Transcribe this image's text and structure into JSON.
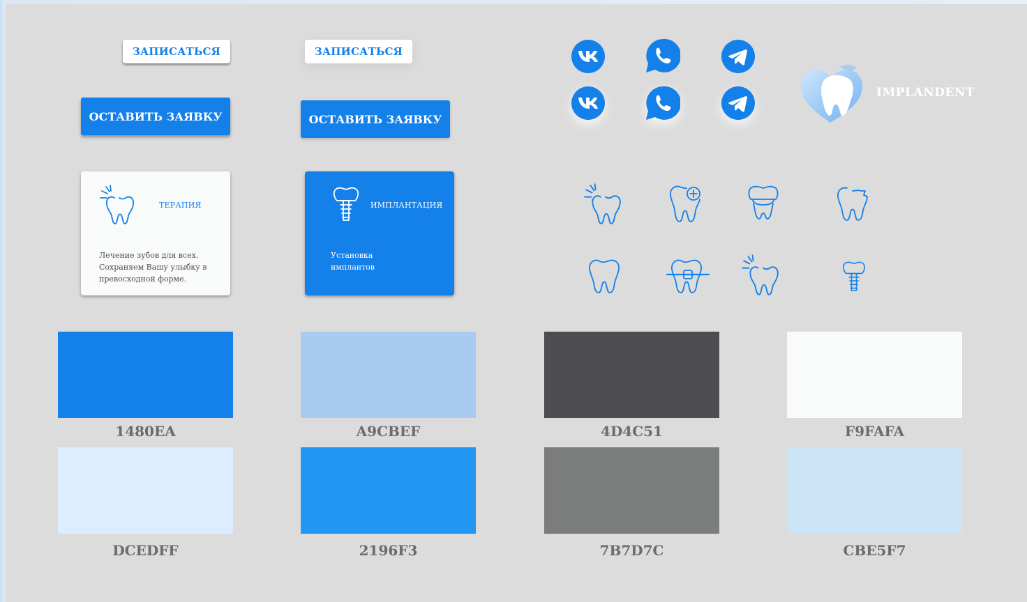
{
  "buttons": {
    "signup_label": "ЗАПИСАТЬСЯ",
    "apply_label": "ОСТАВИТЬ ЗАЯВКУ"
  },
  "cards": [
    {
      "title": "ТЕРАПИЯ",
      "description": "Лечение зубов для всех. Сохраняем Вашу улыбку в превосходной форме."
    },
    {
      "title": "ИМПЛАНТАЦИЯ",
      "description": "Установка имплантов"
    }
  ],
  "social_icons": [
    "vk-icon",
    "whatsapp-icon",
    "telegram-icon"
  ],
  "logo": {
    "text": "IMPLANDENT"
  },
  "tooth_icons": [
    "tooth-sensitive-icon",
    "tooth-cross-icon",
    "tooth-crown-icon",
    "tooth-chipped-icon",
    "tooth-icon",
    "tooth-braces-icon",
    "tooth-sensitive-icon",
    "tooth-implant-icon"
  ],
  "palette": [
    {
      "hex": "#1480EA",
      "label": "1480EA"
    },
    {
      "hex": "#A9CBEF",
      "label": "A9CBEF"
    },
    {
      "hex": "#4D4C51",
      "label": "4D4C51"
    },
    {
      "hex": "#F9FAFA",
      "label": "F9FAFA"
    },
    {
      "hex": "#DCEDFF",
      "label": "DCEDFF"
    },
    {
      "hex": "#2196F3",
      "label": "2196F3"
    },
    {
      "hex": "#7B7D7C",
      "label": "7B7D7C"
    },
    {
      "hex": "#CBE5F7",
      "label": "CBE5F7"
    }
  ],
  "colors": {
    "accent": "#1480EA",
    "background": "#DCDCDC"
  }
}
